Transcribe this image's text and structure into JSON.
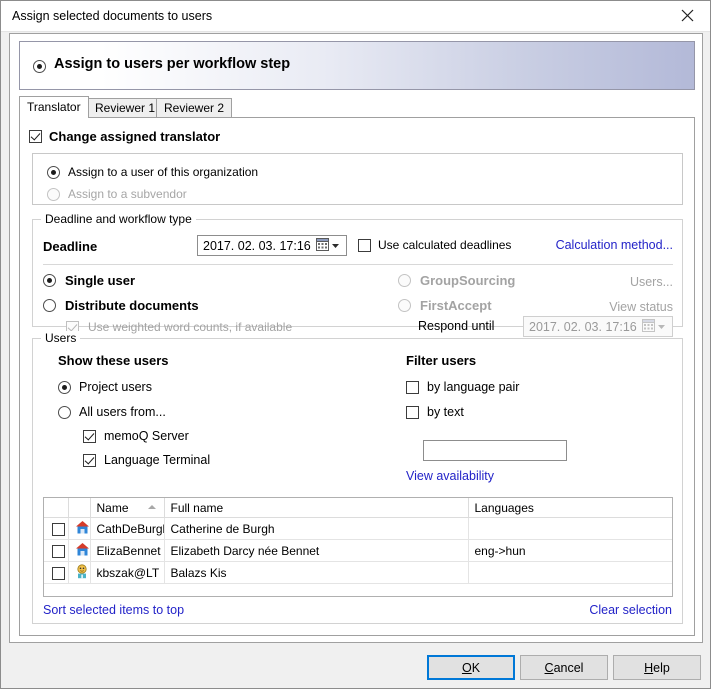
{
  "window": {
    "title": "Assign selected documents to users",
    "close_icon": "close-icon"
  },
  "banner": {
    "label": "Assign to users per workflow step",
    "selected": true
  },
  "tabs": [
    {
      "label": "Translator",
      "active": true
    },
    {
      "label": "Reviewer 1",
      "active": false
    },
    {
      "label": "Reviewer 2",
      "active": false
    }
  ],
  "change_assigned": {
    "label": "Change assigned translator",
    "checked": true
  },
  "assignment_target": {
    "options": [
      {
        "label": "Assign to a user of this organization",
        "selected": true,
        "disabled": false
      },
      {
        "label": "Assign to a subvendor",
        "selected": false,
        "disabled": true
      }
    ]
  },
  "deadline_group": {
    "title": "Deadline and workflow type",
    "deadline_label": "Deadline",
    "deadline_value": "2017. 02. 03. 17:16",
    "use_calculated_deadlines": {
      "label": "Use calculated deadlines",
      "checked": false
    },
    "calculation_method_link": "Calculation method...",
    "workflow": {
      "single_user": {
        "label": "Single user",
        "selected": true
      },
      "distribute_documents": {
        "label": "Distribute documents",
        "selected": false
      },
      "weighted_word_counts": {
        "label": "Use weighted word counts, if available",
        "checked": true,
        "disabled": true
      },
      "group_sourcing": {
        "label": "GroupSourcing",
        "selected": false,
        "disabled": true
      },
      "group_sourcing_link": "Users...",
      "first_accept": {
        "label": "FirstAccept",
        "selected": false,
        "disabled": true
      },
      "first_accept_link": "View status",
      "respond_until_label": "Respond until",
      "respond_until_value": "2017. 02. 03. 17:16"
    }
  },
  "users_group": {
    "title": "Users",
    "show_these_users": {
      "heading": "Show these users",
      "options": [
        {
          "label": "Project users",
          "selected": true
        },
        {
          "label": "All users from...",
          "selected": false
        }
      ],
      "sources": [
        {
          "label": "memoQ Server",
          "checked": true
        },
        {
          "label": "Language Terminal",
          "checked": true
        }
      ]
    },
    "filter_users": {
      "heading": "Filter users",
      "by_language_pair": {
        "label": "by language pair",
        "checked": false
      },
      "by_text": {
        "label": "by text",
        "checked": false
      },
      "text_value": "",
      "text_placeholder": "",
      "view_availability_link": "View availability"
    },
    "table": {
      "columns": [
        "",
        "",
        "Name",
        "Full name",
        "Languages"
      ],
      "sorted_column": "Name",
      "sort_direction": "asc",
      "rows": [
        {
          "selected": false,
          "icon": "house-icon",
          "name": "CathDeBurgh",
          "full_name": "Catherine de Burgh",
          "languages": ""
        },
        {
          "selected": false,
          "icon": "house-icon",
          "name": "ElizaBennet",
          "full_name": "Elizabeth Darcy née Bennet",
          "languages": "eng->hun"
        },
        {
          "selected": false,
          "icon": "user-icon",
          "name": "kbszak@LT",
          "full_name": "Balazs Kis",
          "languages": ""
        }
      ]
    },
    "sort_selected_link": "Sort selected items to top",
    "clear_selection_link": "Clear selection"
  },
  "footer": {
    "ok": {
      "pre": "",
      "mnemonic": "O",
      "post": "K"
    },
    "cancel": {
      "pre": "",
      "mnemonic": "C",
      "post": "ancel"
    },
    "help": {
      "pre": "",
      "mnemonic": "H",
      "post": "elp"
    }
  },
  "colors": {
    "link": "#2323c8",
    "disabled_text": "#a3a3a3",
    "default_button_border": "#0078d7",
    "banner_gradient_end": "#b3b9d8"
  }
}
